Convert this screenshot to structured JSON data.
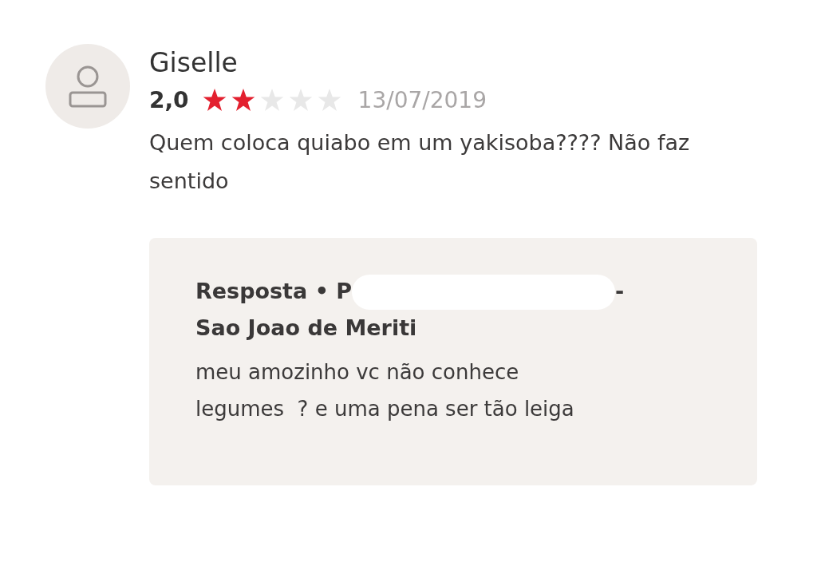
{
  "review": {
    "author": "Giselle",
    "rating": "2,0",
    "stars": 2,
    "date": "13/07/2019",
    "text": "Quem coloca quiabo em um yakisoba???? Não faz sentido"
  },
  "reply": {
    "title_start": "Resposta • P",
    "title_end": "-",
    "redacted": true,
    "location": "Sao Joao de Meriti",
    "text": "meu amozinho vc não conhece legumes  ? e uma pena ser tão leiga"
  }
}
